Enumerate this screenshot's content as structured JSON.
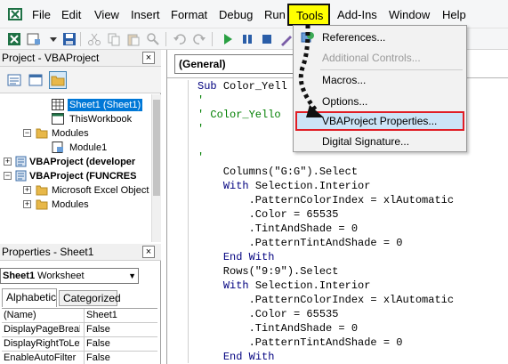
{
  "menubar": {
    "items": [
      {
        "key": "file",
        "label": "File"
      },
      {
        "key": "edit",
        "label": "Edit"
      },
      {
        "key": "view",
        "label": "View"
      },
      {
        "key": "insert",
        "label": "Insert"
      },
      {
        "key": "format",
        "label": "Format"
      },
      {
        "key": "debug",
        "label": "Debug"
      },
      {
        "key": "run",
        "label": "Run"
      },
      {
        "key": "tools",
        "label": "Tools"
      },
      {
        "key": "addins",
        "label": "Add-Ins"
      },
      {
        "key": "window",
        "label": "Window"
      },
      {
        "key": "help",
        "label": "Help"
      }
    ],
    "highlight_color": "#ffff00"
  },
  "project": {
    "title": "Project - VBAProject",
    "tree": [
      {
        "label": "Sheet1 (Sheet1)",
        "icon": "worksheet-icon",
        "selected": true
      },
      {
        "label": "ThisWorkbook",
        "icon": "workbook-icon"
      },
      {
        "label": "Modules",
        "icon": "folder-icon",
        "expander": "−"
      },
      {
        "label": "Module1",
        "icon": "module-icon"
      },
      {
        "label": "VBAProject (developer",
        "icon": "vbaproject-icon",
        "expander": "+",
        "bold": true
      },
      {
        "label": "VBAProject (FUNCRES",
        "icon": "vbaproject-icon",
        "expander": "−",
        "bold": true
      },
      {
        "label": "Microsoft Excel Object",
        "icon": "folder-icon",
        "expander": "+"
      },
      {
        "label": "Modules",
        "icon": "folder-icon",
        "expander": "+"
      }
    ]
  },
  "properties": {
    "title": "Properties - Sheet1",
    "object_name": "Sheet1",
    "object_type": "Worksheet",
    "tabs": {
      "alphabetic": "Alphabetic",
      "categorized": "Categorized"
    },
    "rows": [
      {
        "name": "(Name)",
        "value": "Sheet1"
      },
      {
        "name": "DisplayPageBreak",
        "value": "False"
      },
      {
        "name": "DisplayRightToLef",
        "value": "False"
      },
      {
        "name": "EnableAutoFilter",
        "value": "False"
      }
    ]
  },
  "code": {
    "object_combo": "(General)",
    "lines": [
      {
        "segments": [
          {
            "t": "Sub ",
            "c": "kw"
          },
          {
            "t": "Color_Yell"
          }
        ]
      },
      {
        "segments": [
          {
            "t": "'",
            "c": "cm"
          }
        ]
      },
      {
        "segments": [
          {
            "t": "' Color_Yello",
            "c": "cm"
          }
        ]
      },
      {
        "segments": [
          {
            "t": "'",
            "c": "cm"
          }
        ]
      },
      {
        "segments": [
          {
            "t": ""
          }
        ]
      },
      {
        "segments": [
          {
            "t": "'",
            "c": "cm"
          }
        ]
      },
      {
        "segments": [
          {
            "t": "    Columns(\"G:G\").Select"
          }
        ]
      },
      {
        "segments": [
          {
            "t": "    "
          },
          {
            "t": "With",
            "c": "kw"
          },
          {
            "t": " Selection.Interior"
          }
        ]
      },
      {
        "segments": [
          {
            "t": "        .PatternColorIndex = xlAutomatic"
          }
        ]
      },
      {
        "segments": [
          {
            "t": "        .Color = 65535"
          }
        ]
      },
      {
        "segments": [
          {
            "t": "        .TintAndShade = 0"
          }
        ]
      },
      {
        "segments": [
          {
            "t": "        .PatternTintAndShade = 0"
          }
        ]
      },
      {
        "segments": [
          {
            "t": "    "
          },
          {
            "t": "End With",
            "c": "kw"
          }
        ]
      },
      {
        "segments": [
          {
            "t": "    Rows(\"9:9\").Select"
          }
        ]
      },
      {
        "segments": [
          {
            "t": "    "
          },
          {
            "t": "With",
            "c": "kw"
          },
          {
            "t": " Selection.Interior"
          }
        ]
      },
      {
        "segments": [
          {
            "t": "        .PatternColorIndex = xlAutomatic"
          }
        ]
      },
      {
        "segments": [
          {
            "t": "        .Color = 65535"
          }
        ]
      },
      {
        "segments": [
          {
            "t": "        .TintAndShade = 0"
          }
        ]
      },
      {
        "segments": [
          {
            "t": "        .PatternTintAndShade = 0"
          }
        ]
      },
      {
        "segments": [
          {
            "t": "    "
          },
          {
            "t": "End With",
            "c": "kw"
          }
        ]
      }
    ]
  },
  "tools_menu": {
    "items": [
      {
        "key": "references",
        "label": "References...",
        "icon": "references-icon"
      },
      {
        "key": "additional_controls",
        "label": "Additional Controls...",
        "disabled": true
      },
      {
        "key": "macros",
        "label": "Macros..."
      },
      {
        "key": "options",
        "label": "Options..."
      },
      {
        "key": "vbaproject_properties",
        "label": "VBAProject Properties...",
        "highlighted": true
      },
      {
        "key": "digital_signature",
        "label": "Digital Signature..."
      }
    ],
    "highlight_border_color": "#e01e26"
  }
}
